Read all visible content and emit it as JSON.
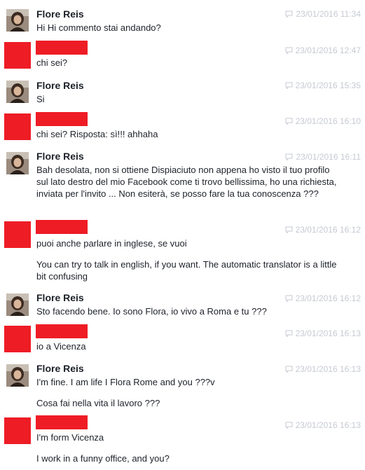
{
  "thread": {
    "messages": [
      {
        "sender": "Flore Reis",
        "timestamp": "23/01/2016 11:34",
        "redacted": false,
        "paragraphs": [
          "Hi Hi commento stai andando?"
        ]
      },
      {
        "sender": "",
        "timestamp": "23/01/2016 12:47",
        "redacted": true,
        "paragraphs": [
          "chi sei?"
        ]
      },
      {
        "sender": "Flore Reis",
        "timestamp": "23/01/2016 15:35",
        "redacted": false,
        "paragraphs": [
          "Si"
        ]
      },
      {
        "sender": "",
        "timestamp": "23/01/2016 16:10",
        "redacted": true,
        "paragraphs": [
          "chi sei? Risposta: sì!!! ahhaha"
        ]
      },
      {
        "sender": "Flore Reis",
        "timestamp": "23/01/2016 16:11",
        "redacted": false,
        "paragraphs": [
          "Bah desolata, non si ottiene Dispiaciuto non appena ho visto il tuo profilo sul lato destro del mio Facebook come ti trovo bellissima, ho una richiesta, inviata per l'invito ... Non esiterà, se posso fare la tua conoscenza ???"
        ]
      },
      {
        "sender": "",
        "timestamp": "23/01/2016 16:12",
        "redacted": true,
        "paragraphs": [
          "puoi anche parlare in inglese, se vuoi",
          "You can try to talk in english, if you want. The automatic translator is a little bit confusing"
        ]
      },
      {
        "sender": "Flore Reis",
        "timestamp": "23/01/2016 16:12",
        "redacted": false,
        "paragraphs": [
          "Sto facendo bene. Io sono Flora, io vivo a Roma e tu ???"
        ]
      },
      {
        "sender": "",
        "timestamp": "23/01/2016 16:13",
        "redacted": true,
        "paragraphs": [
          "io a Vicenza"
        ]
      },
      {
        "sender": "Flore Reis",
        "timestamp": "23/01/2016 16:13",
        "redacted": false,
        "paragraphs": [
          "I'm fine. I am life I Flora Rome and you ???v",
          "Cosa fai nella vita il lavoro ???"
        ]
      },
      {
        "sender": "",
        "timestamp": "23/01/2016 16:13",
        "redacted": true,
        "paragraphs": [
          "I'm form Vicenza",
          "I work in a funny office, and you?"
        ]
      }
    ]
  },
  "colors": {
    "redaction": "#ee1c25",
    "timestamp": "#c6cad2",
    "text": "#1d2129"
  },
  "icons": {
    "timestamp_icon": "speech-bubble-icon"
  }
}
